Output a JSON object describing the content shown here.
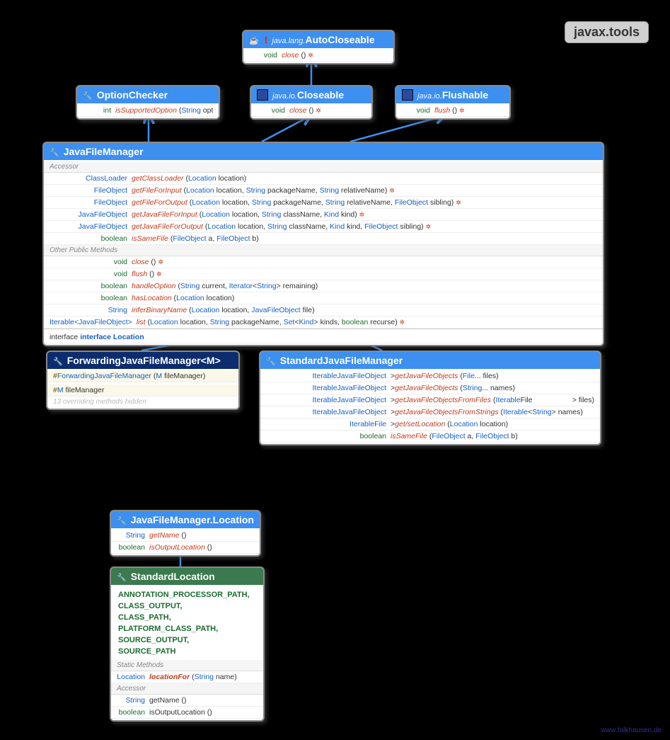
{
  "package": "javax.tools",
  "footer": "www.falkhausen.de",
  "boxes": {
    "autocloseable": {
      "pre": "java.lang.",
      "name": "AutoCloseable",
      "methods": [
        {
          "ret": "void",
          "name": "close",
          "args": "()",
          "throws": true
        }
      ]
    },
    "closeable": {
      "pre": "java.io.",
      "name": "Closeable",
      "methods": [
        {
          "ret": "void",
          "name": "close",
          "args": "()",
          "throws": true
        }
      ]
    },
    "flushable": {
      "pre": "java.io.",
      "name": "Flushable",
      "methods": [
        {
          "ret": "void",
          "name": "flush",
          "args": "()",
          "throws": true
        }
      ]
    },
    "optionchecker": {
      "name": "OptionChecker",
      "methods": [
        {
          "ret": "int",
          "name": "isSupportedOption",
          "args": "(String option)"
        }
      ]
    },
    "jfm": {
      "name": "JavaFileManager",
      "accessor": [
        {
          "ret": "ClassLoader",
          "name": "getClassLoader",
          "args": "(Location location)"
        },
        {
          "ret": "FileObject",
          "name": "getFileForInput",
          "args": "(Location location, String packageName, String relativeName)",
          "throws": true
        },
        {
          "ret": "FileObject",
          "name": "getFileForOutput",
          "args": "(Location location, String packageName, String relativeName, FileObject sibling)",
          "throws": true
        },
        {
          "ret": "JavaFileObject",
          "name": "getJavaFileForInput",
          "args": "(Location location, String className, Kind kind)",
          "throws": true
        },
        {
          "ret": "JavaFileObject",
          "name": "getJavaFileForOutput",
          "args": "(Location location, String className, Kind kind, FileObject sibling)",
          "throws": true
        },
        {
          "ret": "boolean",
          "name": "isSameFile",
          "args": "(FileObject a, FileObject b)"
        }
      ],
      "other": [
        {
          "ret": "void",
          "name": "close",
          "args": "()",
          "throws": true
        },
        {
          "ret": "void",
          "name": "flush",
          "args": "()",
          "throws": true
        },
        {
          "ret": "boolean",
          "name": "handleOption",
          "args": "(String current, Iterator<String> remaining)"
        },
        {
          "ret": "boolean",
          "name": "hasLocation",
          "args": "(Location location)"
        },
        {
          "ret": "String",
          "name": "inferBinaryName",
          "args": "(Location location, JavaFileObject file)"
        },
        {
          "ret": "Iterable<JavaFileObject>",
          "name": "list",
          "args": "(Location location, String packageName, Set<Kind> kinds, boolean recurse)",
          "throws": true
        }
      ],
      "inner": "interface Location"
    },
    "fjfm": {
      "name": "ForwardingJavaFileManager<M>",
      "ctor": "ForwardingJavaFileManager (M fileManager)",
      "field": "M fileManager",
      "hidden": "13 overriding methods hidden"
    },
    "sjfm": {
      "name": "StandardJavaFileManager",
      "methods": [
        {
          "ret": "Iterable<? extends JavaFileObject>",
          "name": "getJavaFileObjects",
          "args": "(File... files)"
        },
        {
          "ret": "Iterable<? extends JavaFileObject>",
          "name": "getJavaFileObjects",
          "args": "(String... names)"
        },
        {
          "ret": "Iterable<? extends JavaFileObject>",
          "name": "getJavaFileObjectsFromFiles",
          "args": "(Iterable<? extends File> files)"
        },
        {
          "ret": "Iterable<? extends JavaFileObject>",
          "name": "getJavaFileObjectsFromStrings",
          "args": "(Iterable<String> names)"
        },
        {
          "ret": "Iterable<? extends File>",
          "name": "get/setLocation",
          "args": "(Location location)"
        },
        {
          "ret": "boolean",
          "name": "isSameFile",
          "args": "(FileObject a, FileObject b)"
        }
      ]
    },
    "loc": {
      "name": "JavaFileManager.Location",
      "methods": [
        {
          "ret": "String",
          "name": "getName",
          "args": "()"
        },
        {
          "ret": "boolean",
          "name": "isOutputLocation",
          "args": "()"
        }
      ]
    },
    "stdloc": {
      "name": "StandardLocation",
      "values": [
        "ANNOTATION_PROCESSOR_PATH,",
        "CLASS_OUTPUT,",
        "CLASS_PATH,",
        "PLATFORM_CLASS_PATH,",
        "SOURCE_OUTPUT,",
        "SOURCE_PATH"
      ],
      "static": [
        {
          "ret": "Location",
          "name": "locationFor",
          "args": "(String name)"
        }
      ],
      "accessor": [
        {
          "ret": "String",
          "name": "getName",
          "args": "()",
          "plain": true
        },
        {
          "ret": "boolean",
          "name": "isOutputLocation",
          "args": "()",
          "plain": true
        }
      ]
    }
  },
  "labels": {
    "accessor": "Accessor",
    "other": "Other Public Methods",
    "static": "Static Methods"
  }
}
